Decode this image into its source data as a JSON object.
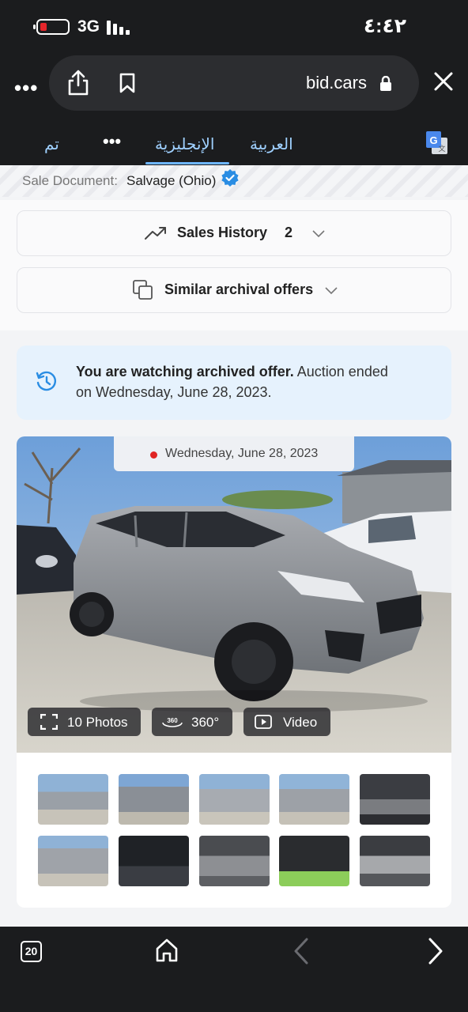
{
  "status_bar": {
    "network": "3G",
    "time": "٤:٤٢",
    "battery_color": "#e5252a"
  },
  "browser": {
    "url": "bid.cars",
    "menu_icon": "more-dots-icon",
    "share_icon": "share-icon",
    "bookmark_icon": "bookmark-icon",
    "lock_icon": "lock-icon",
    "close_icon": "close-icon"
  },
  "translate_bar": {
    "done": "تم",
    "more": "•••",
    "english": "الإنجليزية",
    "arabic": "العربية",
    "icon": "google-translate-icon"
  },
  "sale_document": {
    "label": "Sale Document:",
    "value": "Salvage (Ohio)"
  },
  "sales_history": {
    "label": "Sales History",
    "count": "2"
  },
  "similar_offers": {
    "label": "Similar archival offers"
  },
  "notice": {
    "bold": "You are watching archived offer.",
    "rest": " Auction ended on Wednesday, June 28, 2023."
  },
  "gallery": {
    "date": "Wednesday, June 28, 2023",
    "photos_btn": "10 Photos",
    "view360_btn": "360°",
    "video_btn": "Video",
    "thumb_count": 10
  },
  "bottom_bar": {
    "tabs": "20",
    "home_icon": "home-icon",
    "back_icon": "back-arrow-icon",
    "forward_icon": "forward-arrow-icon"
  }
}
